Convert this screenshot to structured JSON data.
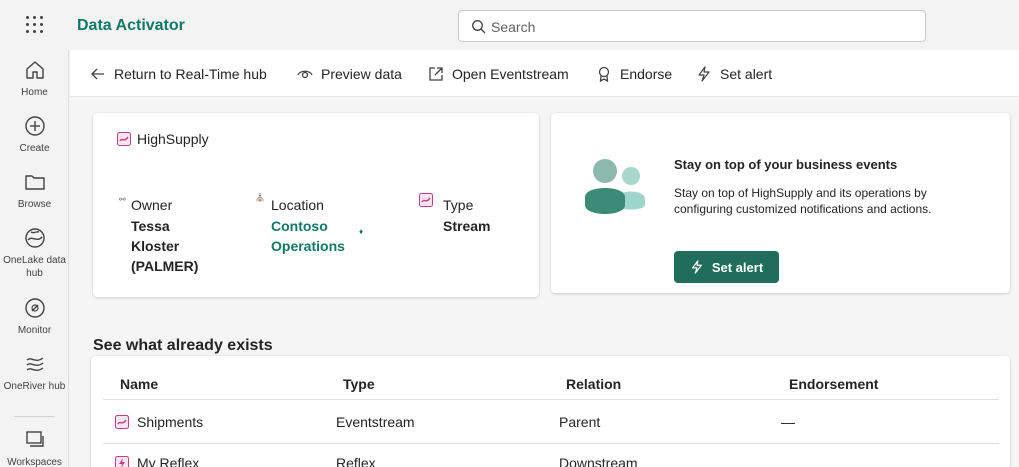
{
  "app": {
    "title": "Data Activator"
  },
  "search": {
    "placeholder": "Search"
  },
  "leftnav": {
    "items": [
      {
        "label": "Home",
        "icon": "home-icon"
      },
      {
        "label": "Create",
        "icon": "plus-circle-icon"
      },
      {
        "label": "Browse",
        "icon": "folder-icon"
      },
      {
        "label": "OneLake data hub",
        "icon": "onelake-icon"
      },
      {
        "label": "Monitor",
        "icon": "monitor-icon"
      },
      {
        "label": "OneRiver hub",
        "icon": "river-icon"
      },
      {
        "label": "Workspaces",
        "icon": "workspaces-icon"
      }
    ]
  },
  "toolbar": {
    "return_label": "Return to Real-Time hub",
    "preview_label": "Preview data",
    "open_label": "Open Eventstream",
    "endorse_label": "Endorse",
    "set_alert_label": "Set alert"
  },
  "info": {
    "name": "HighSupply",
    "owner_label": "Owner",
    "owner_value": "Tessa Kloster (PALMER)",
    "location_label": "Location",
    "location_value": "Contoso Operations",
    "type_label": "Type",
    "type_value": "Stream"
  },
  "alert_card": {
    "title": "Stay on top of your business events",
    "description": "Stay on top of HighSupply and its operations by configuring customized notifications and actions.",
    "button_label": "Set alert"
  },
  "related": {
    "title": "See what already exists",
    "columns": [
      "Name",
      "Type",
      "Relation",
      "Endorsement"
    ],
    "rows": [
      {
        "name": "Shipments",
        "type": "Eventstream",
        "relation": "Parent",
        "endorsement": "—"
      },
      {
        "name": "My Reflex",
        "type": "Reflex",
        "relation": "Downstream",
        "endorsement": ""
      }
    ]
  },
  "colors": {
    "accent": "#117865",
    "button": "#1f6d5a",
    "item_icon": "#c03f8a"
  }
}
